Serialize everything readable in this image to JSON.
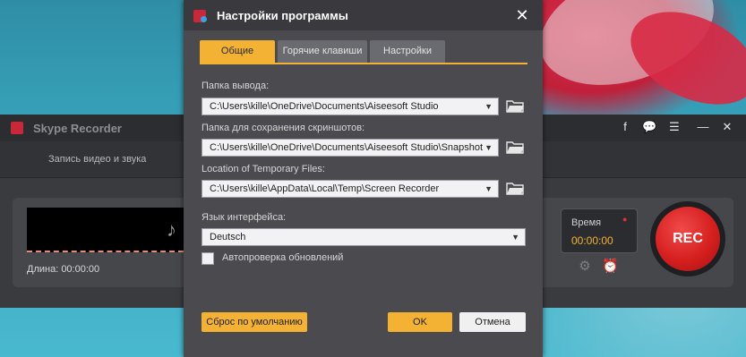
{
  "app": {
    "name": "Skype Recorder",
    "tab_label": "Запись видео и звука",
    "duration_label": "Длина: 00:00:00",
    "time_label": "Время",
    "time_value": "00:00:00",
    "rec_label": "REC",
    "icons": [
      "facebook-icon",
      "chat-icon",
      "menu-icon",
      "minimize-icon",
      "close-icon",
      "gear-icon",
      "alarm-icon"
    ]
  },
  "dialog": {
    "title": "Настройки программы",
    "tabs": [
      {
        "label": "Общие",
        "active": true
      },
      {
        "label": "Горячие клавиши",
        "active": false
      },
      {
        "label": "Настройки",
        "active": false
      }
    ],
    "output_folder": {
      "label": "Папка вывода:",
      "value": "C:\\Users\\kille\\OneDrive\\Documents\\Aiseesoft Studio"
    },
    "screenshot_folder": {
      "label": "Папка для сохранения скриншотов:",
      "value": "C:\\Users\\kille\\OneDrive\\Documents\\Aiseesoft Studio\\Snapshot"
    },
    "temp_folder": {
      "label": "Location of Temporary Files:",
      "value": "C:\\Users\\kille\\AppData\\Local\\Temp\\Screen Recorder"
    },
    "language": {
      "label": "Язык интерфейса:",
      "value": "Deutsch"
    },
    "auto_update": {
      "label": "Автопроверка обновлений",
      "checked": false
    },
    "buttons": {
      "reset": "Сброс по умолчанию",
      "ok": "OK",
      "cancel": "Отмена"
    }
  },
  "colors": {
    "accent": "#f3b233",
    "rec_red": "#d61f1f",
    "dialog_bg": "#4b4b4f"
  }
}
